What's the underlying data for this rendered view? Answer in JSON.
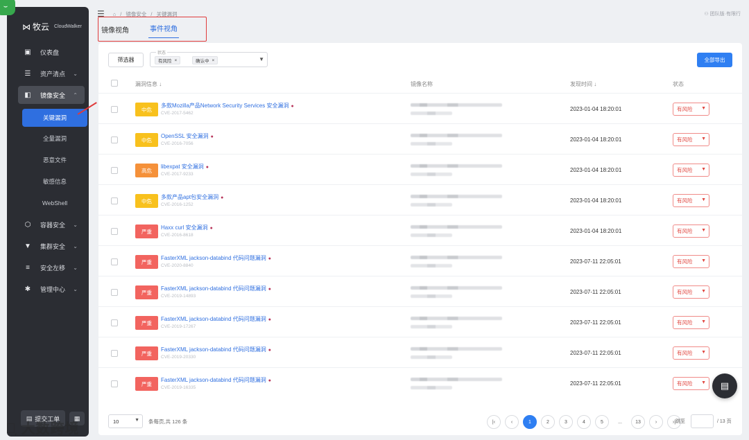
{
  "brand": {
    "name": "牧云",
    "sub": "CloudWalker"
  },
  "sidebar": {
    "items": [
      {
        "label": "仪表盘"
      },
      {
        "label": "资产清点"
      },
      {
        "label": "镜像安全"
      },
      {
        "label": "容器安全"
      },
      {
        "label": "集群安全"
      },
      {
        "label": "安全左移"
      },
      {
        "label": "管理中心"
      }
    ],
    "subitems": [
      {
        "label": "关键漏洞"
      },
      {
        "label": "全量漏洞"
      },
      {
        "label": "恶意文件"
      },
      {
        "label": "敏感信息"
      },
      {
        "label": "WebShell"
      }
    ],
    "bottom_button": "提交工单"
  },
  "breadcrumb": {
    "parent": "镜像安全",
    "sep": "/",
    "current": "关键漏洞"
  },
  "team": "团队版·有限行",
  "tabs": [
    {
      "label": "镜像视角"
    },
    {
      "label": "事件视角"
    }
  ],
  "toolbar": {
    "filter_label": "筛选器",
    "status_label": "状态",
    "chips": [
      "有风险",
      "确认中"
    ],
    "export_label": "全部导出"
  },
  "table": {
    "headers": {
      "vuln": "漏洞信息",
      "image": "镜像名称",
      "time": "发现时间",
      "status": "状态"
    },
    "rows": [
      {
        "sev": "中危",
        "sevClass": "mid",
        "name": "多款Mozilla产品Network Security Services 安全漏洞",
        "cve": "CVE-2017-5462",
        "time": "2023-01-04 18:20:01",
        "status": "有风险"
      },
      {
        "sev": "中危",
        "sevClass": "mid",
        "name": "OpenSSL 安全漏洞",
        "cve": "CVE-2016-7056",
        "time": "2023-01-04 18:20:01",
        "status": "有风险"
      },
      {
        "sev": "高危",
        "sevClass": "high",
        "name": "libexpat 安全漏洞",
        "cve": "CVE-2017-9233",
        "time": "2023-01-04 18:20:01",
        "status": "有风险"
      },
      {
        "sev": "中危",
        "sevClass": "mid",
        "name": "多款产品apt包安全漏洞",
        "cve": "CVE-2016-1252",
        "time": "2023-01-04 18:20:01",
        "status": "有风险"
      },
      {
        "sev": "严重",
        "sevClass": "crit",
        "name": "Haxx curl 安全漏洞",
        "cve": "CVE-2016-8618",
        "time": "2023-01-04 18:20:01",
        "status": "有风险"
      },
      {
        "sev": "严重",
        "sevClass": "crit",
        "name": "FasterXML jackson-databind 代码问题漏洞",
        "cve": "CVE-2020-8840",
        "time": "2023-07-11 22:05:01",
        "status": "有风险"
      },
      {
        "sev": "严重",
        "sevClass": "crit",
        "name": "FasterXML jackson-databind 代码问题漏洞",
        "cve": "CVE-2019-14893",
        "time": "2023-07-11 22:05:01",
        "status": "有风险"
      },
      {
        "sev": "严重",
        "sevClass": "crit",
        "name": "FasterXML jackson-databind 代码问题漏洞",
        "cve": "CVE-2019-17267",
        "time": "2023-07-11 22:05:01",
        "status": "有风险"
      },
      {
        "sev": "严重",
        "sevClass": "crit",
        "name": "FasterXML jackson-databind 代码问题漏洞",
        "cve": "CVE-2019-20330",
        "time": "2023-07-11 22:05:01",
        "status": "有风险"
      },
      {
        "sev": "严重",
        "sevClass": "crit",
        "name": "FasterXML jackson-databind 代码问题漏洞",
        "cve": "CVE-2019-16335",
        "time": "2023-07-11 22:05:01",
        "status": "有风险"
      }
    ]
  },
  "footer": {
    "page_size": "10",
    "total_text": "条每页,共 126 条",
    "pages": [
      "1",
      "2",
      "3",
      "4",
      "5",
      "...",
      "13"
    ],
    "jump_label": "跳至",
    "jump_total": "/ 13 页"
  },
  "watermark": "大数跨境"
}
